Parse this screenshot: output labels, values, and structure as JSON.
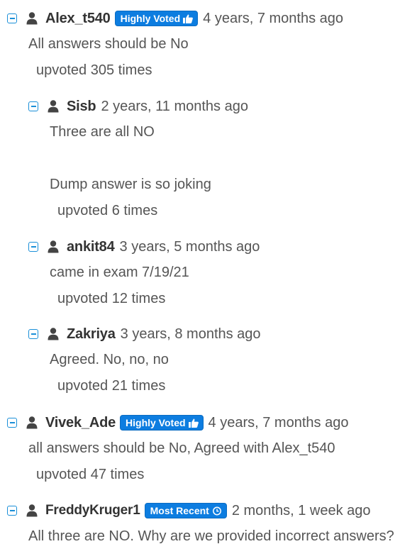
{
  "comments": [
    {
      "username": "Alex_t540",
      "badge": "Highly Voted",
      "badge_icon": "thumbs-up-icon",
      "time": "4 years, 7 months ago",
      "content": "All answers should be No",
      "votes": "upvoted 305 times",
      "replies": [
        {
          "username": "Sisb",
          "time": "2 years, 11 months ago",
          "content_line1": "Three are all NO",
          "content_line2": "Dump answer is so joking",
          "votes": "upvoted 6 times"
        },
        {
          "username": "ankit84",
          "time": "3 years, 5 months ago",
          "content": "came in exam 7/19/21",
          "votes": "upvoted 12 times"
        },
        {
          "username": "Zakriya",
          "time": "3 years, 8 months ago",
          "content": "Agreed. No, no, no",
          "votes": "upvoted 21 times"
        }
      ]
    },
    {
      "username": "Vivek_Ade",
      "badge": "Highly Voted",
      "badge_icon": "thumbs-up-icon",
      "time": "4 years, 7 months ago",
      "content": "all answers should be No, Agreed with Alex_t540",
      "votes": "upvoted 47 times"
    },
    {
      "username": "FreddyKruger1",
      "badge": "Most Recent",
      "badge_icon": "clock-icon",
      "time": "2 months, 1 week ago",
      "content": "All three are NO. Why are we provided incorrect answers?"
    }
  ],
  "colors": {
    "accent": "#0d7de0",
    "toggle": "#1a8fd8",
    "username": "#333333",
    "text": "#555555"
  }
}
